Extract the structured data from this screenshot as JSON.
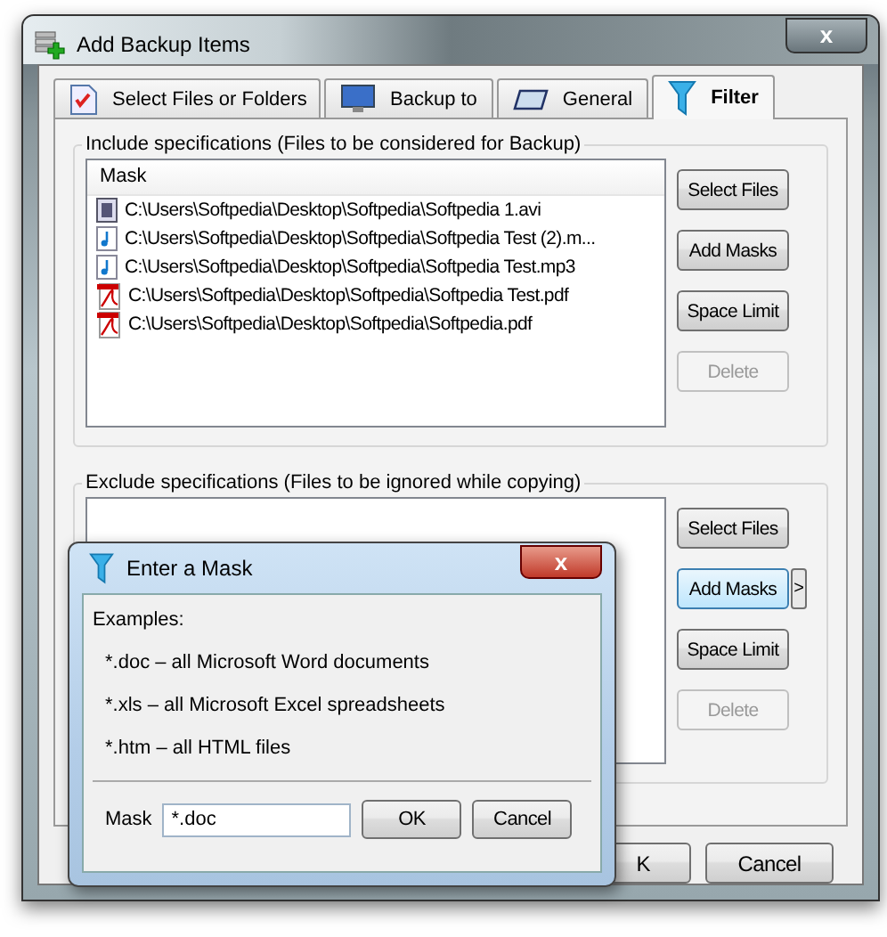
{
  "window": {
    "title": "Add Backup Items",
    "close": "x"
  },
  "tabs": [
    {
      "label": "Select Files or Folders",
      "kind": "checklist",
      "selected": false
    },
    {
      "label": "Backup to",
      "kind": "monitor",
      "selected": false
    },
    {
      "label": "General",
      "kind": "card",
      "selected": false
    },
    {
      "label": "Filter",
      "kind": "filter",
      "selected": true
    }
  ],
  "include": {
    "title": "Include specifications (Files to be considered for Backup)",
    "column": "Mask",
    "rows": [
      {
        "path": "C:\\Users\\Softpedia\\Desktop\\Softpedia\\Softpedia 1.avi",
        "kind": "video"
      },
      {
        "path": "C:\\Users\\Softpedia\\Desktop\\Softpedia\\Softpedia Test (2).m...",
        "kind": "audio"
      },
      {
        "path": "C:\\Users\\Softpedia\\Desktop\\Softpedia\\Softpedia Test.mp3",
        "kind": "audio"
      },
      {
        "path": "C:\\Users\\Softpedia\\Desktop\\Softpedia\\Softpedia Test.pdf",
        "kind": "pdf"
      },
      {
        "path": "C:\\Users\\Softpedia\\Desktop\\Softpedia\\Softpedia.pdf",
        "kind": "pdf"
      }
    ],
    "buttons": [
      {
        "label": "Select Files",
        "disabled": false
      },
      {
        "label": "Add Masks",
        "disabled": false
      },
      {
        "label": "Space Limit",
        "disabled": false
      },
      {
        "label": "Delete",
        "disabled": true
      }
    ]
  },
  "exclude": {
    "title": "Exclude specifications (Files to be ignored while copying)",
    "buttons": [
      {
        "label": "Select Files",
        "disabled": false,
        "focused": false
      },
      {
        "label": "Add Masks",
        "disabled": false,
        "focused": true
      },
      {
        "label": "Space Limit",
        "disabled": false,
        "focused": false
      },
      {
        "label": "Delete",
        "disabled": true,
        "focused": false
      }
    ],
    "more": ">"
  },
  "footer_buttons": [
    "K",
    "Cancel"
  ],
  "dialog": {
    "title": "Enter a Mask",
    "close": "x",
    "heading": "Examples:",
    "examples": [
      "*.doc – all Microsoft Word documents",
      "*.xls – all Microsoft Excel spreadsheets",
      "*.htm – all HTML files"
    ],
    "mask_label": "Mask",
    "mask_value": "*.doc",
    "buttons": [
      "OK",
      "Cancel"
    ]
  }
}
